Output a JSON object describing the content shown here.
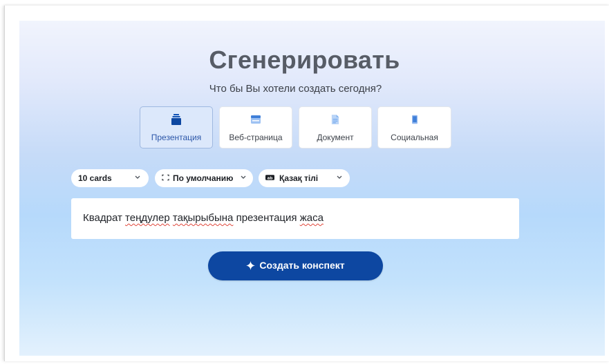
{
  "header": {
    "title": "Сгенерировать",
    "subtitle": "Что бы Вы хотели создать сегодня?"
  },
  "content_types": [
    {
      "label": "Презентация",
      "icon": "stack-icon",
      "active": true
    },
    {
      "label": "Веб-страница",
      "icon": "browser-icon",
      "active": false
    },
    {
      "label": "Документ",
      "icon": "document-icon",
      "active": false
    },
    {
      "label": "Социальная",
      "icon": "phone-icon",
      "active": false
    }
  ],
  "options": {
    "cards": {
      "value": "10 cards",
      "icon": "chevron-down-icon"
    },
    "theme": {
      "value": "По умолчанию",
      "icon": "aspect-ratio-icon"
    },
    "language": {
      "value": "Қазақ тілі",
      "icon": "language-icon"
    }
  },
  "prompt": {
    "words": [
      "Квадрат",
      "теңдулер",
      "тақырыбына",
      "презентация",
      "жаса"
    ]
  },
  "generate_button": {
    "label": "Создать конспект",
    "icon": "sparkle-icon"
  },
  "colors": {
    "accent": "#0d47a1",
    "active_card_bg": "#dce8fb",
    "title": "#575c66",
    "spell_underline": "#e0463a"
  }
}
